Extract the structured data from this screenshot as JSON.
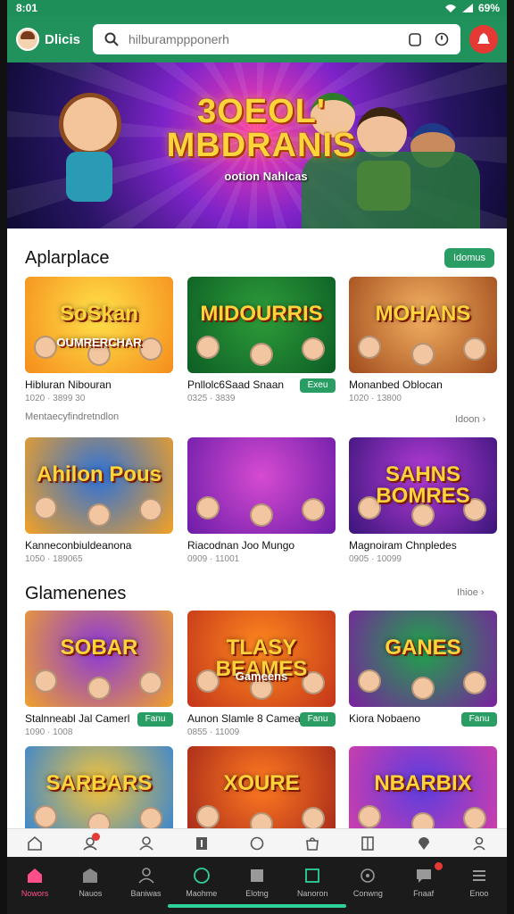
{
  "status": {
    "time": "8:01",
    "battery": "69%"
  },
  "header": {
    "brand": "Dlicis",
    "search_placeholder": "hilburamppponerh"
  },
  "hero": {
    "title_line1": "3OEOL'",
    "title_line2": "MBDRANIS",
    "subtitle": "ootion Nahlcas"
  },
  "sections": [
    {
      "title": "Aplarplace",
      "action": "Idomus",
      "note": "Mentaecyfindretndlon",
      "more": "Idoon",
      "rows": [
        [
          {
            "thumb": "SoSkan",
            "thumb_sub": "OUMRERCHAR",
            "name": "Hibluran Nibouran",
            "meta": "1020 · 3899 30",
            "tag": "",
            "colors": [
              "#ffe24a",
              "#f58c1b"
            ]
          },
          {
            "thumb": "MIDOURRIS",
            "thumb_sub": "",
            "name": "Pnllolc6Saad Snaan",
            "meta": "0325 · 3839",
            "tag": "Exeu",
            "colors": [
              "#2e9d3a",
              "#0c5d24"
            ]
          },
          {
            "thumb": "MOHANS",
            "thumb_sub": "",
            "name": "Monanbed Oblocan",
            "meta": "1020 · 13800",
            "tag": "",
            "colors": [
              "#f3b262",
              "#a04a1c"
            ]
          }
        ],
        [
          {
            "thumb": "Ahilon Pous",
            "thumb_sub": "",
            "name": "Kanneconbiuldeanona",
            "meta": "1050 · 189065",
            "tag": "",
            "colors": [
              "#2d71d9",
              "#f4a123"
            ]
          },
          {
            "thumb": "",
            "thumb_sub": "",
            "name": "Riacodnan Joo Mungo",
            "meta": "0909 · 11001",
            "tag": "",
            "colors": [
              "#d64bd1",
              "#6b1ca8"
            ]
          },
          {
            "thumb": "SAHNS BOMRES",
            "thumb_sub": "",
            "name": "Magnoiram Chnpledes",
            "meta": "0905 · 10099",
            "tag": "",
            "colors": [
              "#b53cd9",
              "#3a1579"
            ]
          }
        ]
      ]
    },
    {
      "title": "Glamenenes",
      "more": "Ihioe",
      "rows": [
        [
          {
            "thumb": "SOBAR",
            "thumb_sub": "",
            "name": "Stalnneabl Jal Camerl",
            "meta": "1090 · 1008",
            "tag": "Fanu",
            "colors": [
              "#8a39d8",
              "#f0a12d"
            ]
          },
          {
            "thumb": "TLASY BEAMES",
            "thumb_sub": "Gameens",
            "name": "Aunon Slamle 8 Camean",
            "meta": "0855 · 11009",
            "tag": "Fanu",
            "colors": [
              "#ff8a1f",
              "#c3341a"
            ]
          },
          {
            "thumb": "GANES",
            "thumb_sub": "",
            "name": "Kiora Nobaeno",
            "meta": "",
            "tag": "Fanu",
            "colors": [
              "#1fa44a",
              "#7a1fa0"
            ]
          }
        ],
        [
          {
            "thumb": "SARBARS",
            "thumb_sub": "",
            "name": "",
            "meta": "",
            "tag": "",
            "colors": [
              "#f5c43a",
              "#2f82d8"
            ]
          },
          {
            "thumb": "XOURE",
            "thumb_sub": "",
            "name": "",
            "meta": "",
            "tag": "",
            "colors": [
              "#ff7a21",
              "#a3261a"
            ]
          },
          {
            "thumb": "NBARBIX",
            "thumb_sub": "",
            "name": "",
            "meta": "",
            "tag": "",
            "colors": [
              "#5a3de0",
              "#d73da8"
            ]
          }
        ]
      ]
    }
  ],
  "tabbar": [
    "home-icon",
    "gift-icon",
    "user-icon",
    "info-icon",
    "emoji-icon",
    "bag-icon",
    "book-icon",
    "pin-icon",
    "profile-icon"
  ],
  "navbar": [
    {
      "label": "Nowors",
      "icon": "home-icon"
    },
    {
      "label": "Nauos",
      "icon": "store-icon"
    },
    {
      "label": "Baniwas",
      "icon": "person-icon"
    },
    {
      "label": "Maohme",
      "icon": "game-icon"
    },
    {
      "label": "Elotng",
      "icon": "box-icon"
    },
    {
      "label": "Nanoron",
      "icon": "chart-icon"
    },
    {
      "label": "Conwng",
      "icon": "circle-icon"
    },
    {
      "label": "Fnaaf",
      "icon": "chat-icon"
    },
    {
      "label": "Enoo",
      "icon": "menu-icon"
    }
  ],
  "colors": {
    "brand": "#22925c",
    "accent": "#2a9d65",
    "active": "#ff4f8b"
  }
}
